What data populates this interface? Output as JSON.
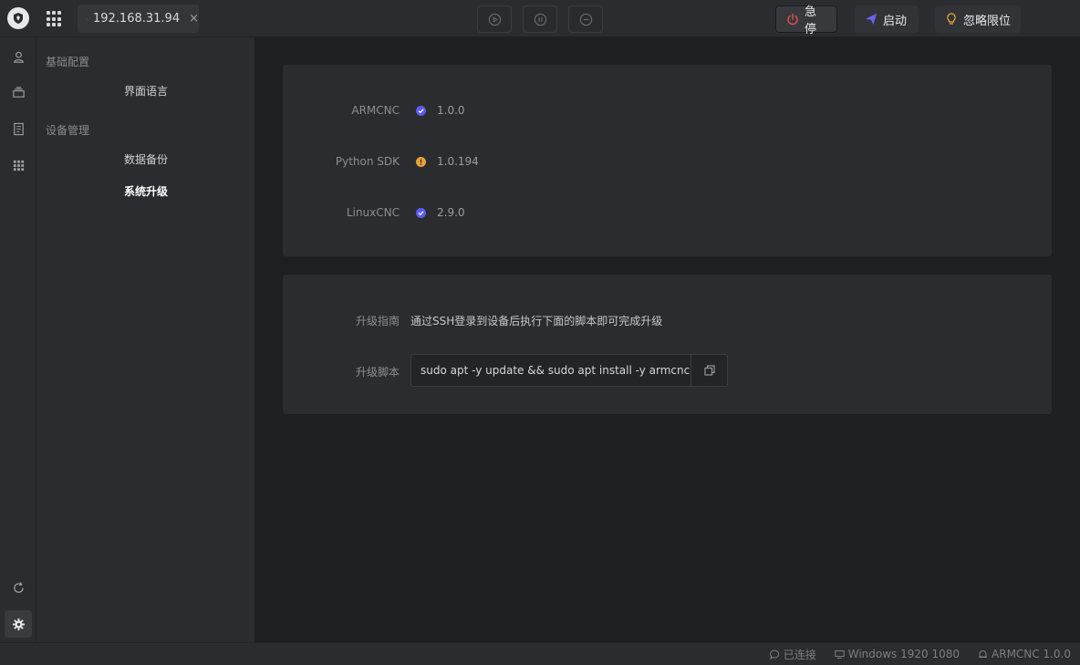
{
  "topbar": {
    "tab_title": "192.168.31.94",
    "tab_close": "×",
    "actions": {
      "estop_label": "急停",
      "start_label": "启动",
      "ignore_limits_label": "忽略限位"
    }
  },
  "subnav": {
    "group_basic": "基础配置",
    "item_language": "界面语言",
    "group_device": "设备管理",
    "item_backup": "数据备份",
    "item_upgrade": "系统升级"
  },
  "versions": [
    {
      "name": "ARMCNC",
      "status": "ok",
      "version": "1.0.0"
    },
    {
      "name": "Python SDK",
      "status": "warning",
      "version": "1.0.194"
    },
    {
      "name": "LinuxCNC",
      "status": "ok",
      "version": "2.9.0"
    }
  ],
  "upgrade": {
    "guide_label": "升级指南",
    "guide_text": "通过SSH登录到设备后执行下面的脚本即可完成升级",
    "script_label": "升级脚本",
    "script_value": "sudo apt -y update && sudo apt install -y armcnc"
  },
  "statusbar": {
    "connection": "已连接",
    "display": "Windows 1920 1080",
    "app_version": "ARMCNC 1.0.0"
  },
  "colors": {
    "ok": "#5b5cf0",
    "warning": "#e8a23a",
    "estop": "#e0524a",
    "start": "#6a62f0",
    "ignore": "#e8a23a"
  }
}
